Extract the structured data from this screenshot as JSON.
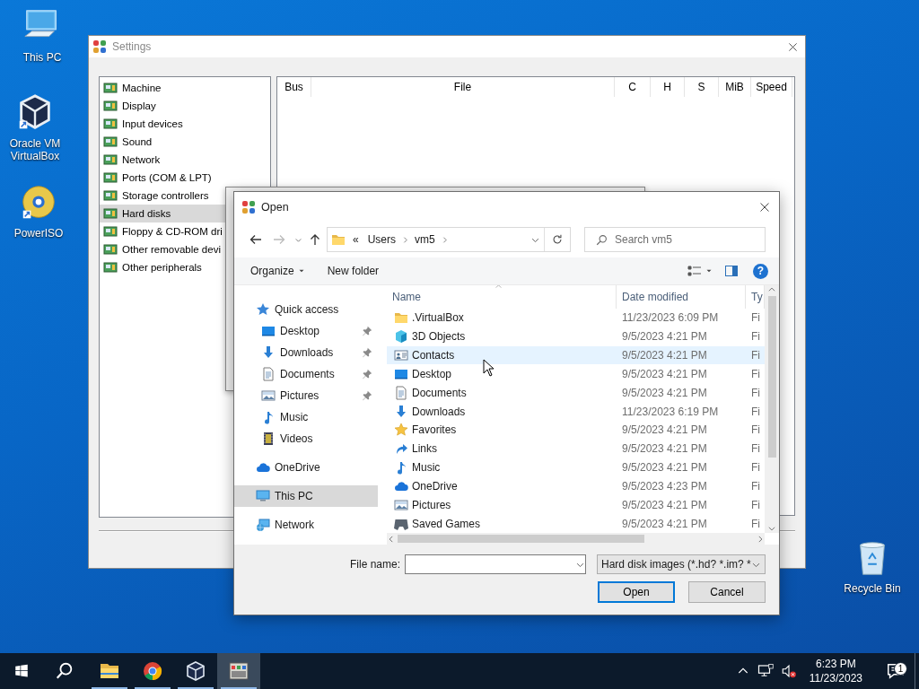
{
  "desktop_icons": [
    {
      "label": "This PC",
      "kind": "pc"
    },
    {
      "label": "Oracle VM VirtualBox",
      "kind": "vbox"
    },
    {
      "label": "PowerISO",
      "kind": "disc"
    },
    {
      "label": "Recycle Bin",
      "kind": "bin"
    }
  ],
  "settings": {
    "title": "Settings",
    "categories": [
      {
        "label": "Machine",
        "selected": false
      },
      {
        "label": "Display",
        "selected": false
      },
      {
        "label": "Input devices",
        "selected": false
      },
      {
        "label": "Sound",
        "selected": false
      },
      {
        "label": "Network",
        "selected": false
      },
      {
        "label": "Ports (COM & LPT)",
        "selected": false
      },
      {
        "label": "Storage controllers",
        "selected": false
      },
      {
        "label": "Hard disks",
        "selected": true
      },
      {
        "label": "Floppy & CD-ROM dri",
        "selected": false
      },
      {
        "label": "Other removable devi",
        "selected": false
      },
      {
        "label": "Other peripherals",
        "selected": false
      }
    ],
    "columns": [
      "Bus",
      "File",
      "C",
      "H",
      "S",
      "MiB",
      "Speed"
    ]
  },
  "open_dialog": {
    "title": "Open",
    "address": {
      "overflow_mark": "«",
      "path": [
        "Users",
        "vm5"
      ],
      "search_placeholder": "Search vm5"
    },
    "toolbar": {
      "organize": "Organize",
      "new_folder": "New folder",
      "help": "?"
    },
    "nav_pane": [
      {
        "label": "Quick access",
        "kind": "quickstar",
        "selected": false,
        "children": [
          {
            "label": "Desktop",
            "kind": "screen",
            "pinned": true,
            "selected": false
          },
          {
            "label": "Downloads",
            "kind": "download",
            "pinned": true,
            "selected": false
          },
          {
            "label": "Documents",
            "kind": "document",
            "pinned": true,
            "selected": false
          },
          {
            "label": "Pictures",
            "kind": "picture",
            "pinned": true,
            "selected": false
          },
          {
            "label": "Music",
            "kind": "music",
            "pinned": false,
            "selected": false
          },
          {
            "label": "Videos",
            "kind": "film",
            "pinned": false,
            "selected": false
          }
        ]
      },
      {
        "label": "OneDrive",
        "kind": "cloud",
        "selected": false
      },
      {
        "label": "This PC",
        "kind": "monitor",
        "selected": true
      },
      {
        "label": "Network",
        "kind": "network",
        "selected": false
      }
    ],
    "columns": [
      "Name",
      "Date modified",
      "Ty"
    ],
    "files": [
      {
        "name": ".VirtualBox",
        "kind": "folder",
        "date": "11/23/2023 6:09 PM",
        "type": "Fi",
        "hovered": false
      },
      {
        "name": "3D Objects",
        "kind": "cube",
        "date": "9/5/2023 4:21 PM",
        "type": "Fi",
        "hovered": false
      },
      {
        "name": "Contacts",
        "kind": "contact",
        "date": "9/5/2023 4:21 PM",
        "type": "Fi",
        "hovered": true
      },
      {
        "name": "Desktop",
        "kind": "screen",
        "date": "9/5/2023 4:21 PM",
        "type": "Fi",
        "hovered": false
      },
      {
        "name": "Documents",
        "kind": "document",
        "date": "9/5/2023 4:21 PM",
        "type": "Fi",
        "hovered": false
      },
      {
        "name": "Downloads",
        "kind": "download",
        "date": "11/23/2023 6:19 PM",
        "type": "Fi",
        "hovered": false
      },
      {
        "name": "Favorites",
        "kind": "star",
        "date": "9/5/2023 4:21 PM",
        "type": "Fi",
        "hovered": false
      },
      {
        "name": "Links",
        "kind": "link",
        "date": "9/5/2023 4:21 PM",
        "type": "Fi",
        "hovered": false
      },
      {
        "name": "Music",
        "kind": "music",
        "date": "9/5/2023 4:21 PM",
        "type": "Fi",
        "hovered": false
      },
      {
        "name": "OneDrive",
        "kind": "cloud",
        "date": "9/5/2023 4:23 PM",
        "type": "Fi",
        "hovered": false
      },
      {
        "name": "Pictures",
        "kind": "picture",
        "date": "9/5/2023 4:21 PM",
        "type": "Fi",
        "hovered": false
      },
      {
        "name": "Saved Games",
        "kind": "gamepad",
        "date": "9/5/2023 4:21 PM",
        "type": "Fi",
        "hovered": false
      }
    ],
    "file_name_label": "File name:",
    "filter": "Hard disk images (*.hd? *.im? *",
    "buttons": [
      {
        "label": "Open",
        "default": true
      },
      {
        "label": "Cancel",
        "default": false
      }
    ]
  },
  "taskbar": {
    "apps": [
      {
        "kind": "folder",
        "running": true,
        "active": false
      },
      {
        "kind": "browser",
        "running": true,
        "active": false
      },
      {
        "kind": "vbox",
        "running": true,
        "active": false
      },
      {
        "kind": "app",
        "running": true,
        "active": true
      }
    ],
    "time": "6:23 PM",
    "date": "11/23/2023",
    "notifications": "1"
  }
}
